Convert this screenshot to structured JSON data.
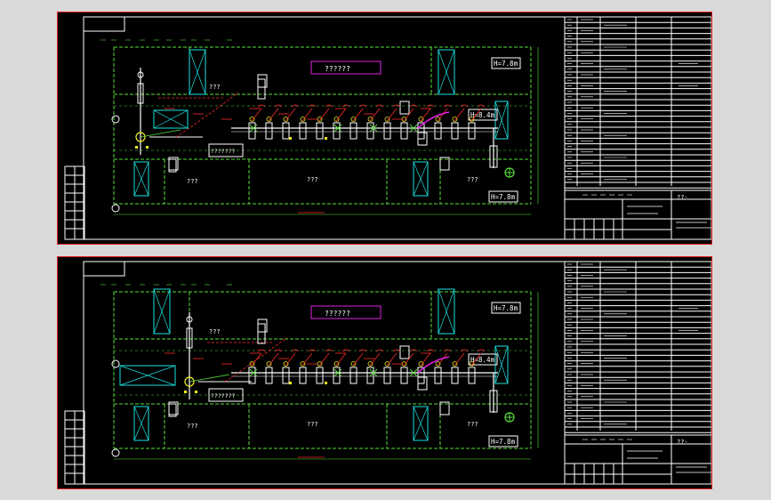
{
  "colors": {
    "background": "#d9d9d9",
    "sheet": "#000000",
    "border": "#e02020",
    "frame": "#ffffff",
    "grid": "#5adc3c",
    "cyan": "#18e0e0",
    "magenta": "#e020e0",
    "red": "#ff2a2a",
    "yellow": "#f0f020",
    "white": "#ffffff"
  },
  "sheets": [
    {
      "name": "sheet-1",
      "banner": "??????",
      "height_tags": [
        "H=7.8m",
        "H=8.4m",
        "H=7.8m"
      ],
      "room_labels": [
        "???",
        "???",
        "???",
        "???"
      ],
      "box_label": "???????",
      "sheet_no": "??-"
    },
    {
      "name": "sheet-2",
      "banner": "??????",
      "height_tags": [
        "H=7.8m",
        "H=8.4m",
        "H=7.8m"
      ],
      "room_labels": [
        "???",
        "???",
        "???",
        "???"
      ],
      "box_label": "???????",
      "sheet_no": "??-"
    }
  ],
  "icons": [
    "equipment-icon",
    "fan-icon",
    "valve-icon",
    "column-icon"
  ]
}
